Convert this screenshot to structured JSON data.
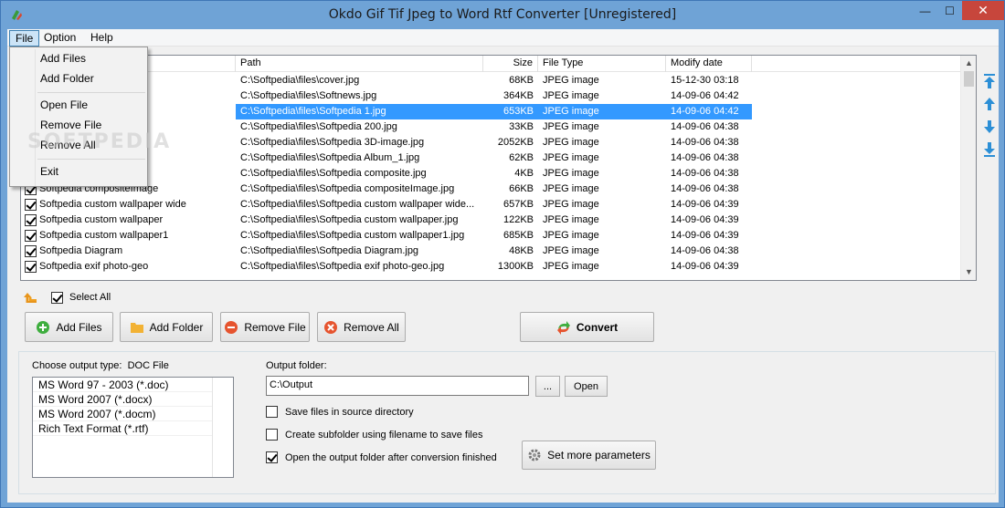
{
  "window": {
    "title": "Okdo Gif Tif Jpeg to Word Rtf Converter [Unregistered]",
    "minimize": "—",
    "maximize": "☐",
    "close": "✕"
  },
  "menubar": {
    "file": "File",
    "option": "Option",
    "help": "Help"
  },
  "file_menu": {
    "add_files": "Add Files",
    "add_folder": "Add Folder",
    "open_file": "Open File",
    "remove_file": "Remove File",
    "remove_all": "Remove All",
    "exit": "Exit"
  },
  "watermark": "SOFTPEDIA",
  "file_list": {
    "columns": {
      "name": "",
      "path": "Path",
      "size": "Size",
      "type": "File Type",
      "date": "Modify date"
    },
    "rows": [
      {
        "name": "",
        "path": "C:\\Softpedia\\files\\cover.jpg",
        "size": "68KB",
        "type": "JPEG image",
        "date": "15-12-30 03:18",
        "checked": true
      },
      {
        "name": "",
        "path": "C:\\Softpedia\\files\\Softnews.jpg",
        "size": "364KB",
        "type": "JPEG image",
        "date": "14-09-06 04:42",
        "checked": true
      },
      {
        "name": "",
        "path": "C:\\Softpedia\\files\\Softpedia 1.jpg",
        "size": "653KB",
        "type": "JPEG image",
        "date": "14-09-06 04:42",
        "checked": true,
        "selected": true
      },
      {
        "name": "",
        "path": "C:\\Softpedia\\files\\Softpedia 200.jpg",
        "size": "33KB",
        "type": "JPEG image",
        "date": "14-09-06 04:38",
        "checked": true
      },
      {
        "name": "",
        "path": "C:\\Softpedia\\files\\Softpedia 3D-image.jpg",
        "size": "2052KB",
        "type": "JPEG image",
        "date": "14-09-06 04:38",
        "checked": true
      },
      {
        "name": "",
        "path": "C:\\Softpedia\\files\\Softpedia Album_1.jpg",
        "size": "62KB",
        "type": "JPEG image",
        "date": "14-09-06 04:38",
        "checked": true
      },
      {
        "name": "",
        "path": "C:\\Softpedia\\files\\Softpedia composite.jpg",
        "size": "4KB",
        "type": "JPEG image",
        "date": "14-09-06 04:38",
        "checked": true
      },
      {
        "name": "Softpedia compositeImage",
        "path": "C:\\Softpedia\\files\\Softpedia compositeImage.jpg",
        "size": "66KB",
        "type": "JPEG image",
        "date": "14-09-06 04:38",
        "checked": true
      },
      {
        "name": "Softpedia custom wallpaper wide",
        "path": "C:\\Softpedia\\files\\Softpedia custom wallpaper wide...",
        "size": "657KB",
        "type": "JPEG image",
        "date": "14-09-06 04:39",
        "checked": true
      },
      {
        "name": "Softpedia custom wallpaper",
        "path": "C:\\Softpedia\\files\\Softpedia custom wallpaper.jpg",
        "size": "122KB",
        "type": "JPEG image",
        "date": "14-09-06 04:39",
        "checked": true
      },
      {
        "name": "Softpedia custom wallpaper1",
        "path": "C:\\Softpedia\\files\\Softpedia custom wallpaper1.jpg",
        "size": "685KB",
        "type": "JPEG image",
        "date": "14-09-06 04:39",
        "checked": true
      },
      {
        "name": "Softpedia Diagram",
        "path": "C:\\Softpedia\\files\\Softpedia Diagram.jpg",
        "size": "48KB",
        "type": "JPEG image",
        "date": "14-09-06 04:38",
        "checked": true
      },
      {
        "name": "Softpedia exif photo-geo",
        "path": "C:\\Softpedia\\files\\Softpedia exif photo-geo.jpg",
        "size": "1300KB",
        "type": "JPEG image",
        "date": "14-09-06 04:39",
        "checked": true
      }
    ]
  },
  "select_all": {
    "label": "Select All",
    "checked": true
  },
  "buttons": {
    "add_files": "Add Files",
    "add_folder": "Add Folder",
    "remove_file": "Remove File",
    "remove_all": "Remove All",
    "convert": "Convert"
  },
  "output": {
    "choose_type_label": "Choose output type:",
    "choose_type_value": "DOC File",
    "formats": [
      "MS Word 97 - 2003 (*.doc)",
      "MS Word 2007 (*.docx)",
      "MS Word 2007 (*.docm)",
      "Rich Text Format (*.rtf)"
    ],
    "folder_label": "Output folder:",
    "folder_value": "C:\\Output",
    "browse": "...",
    "open": "Open",
    "save_in_source": {
      "label": "Save files in source directory",
      "checked": false
    },
    "create_subfolder": {
      "label": "Create subfolder using filename to save files",
      "checked": false
    },
    "open_after": {
      "label": "Open the output folder after conversion finished",
      "checked": true
    },
    "set_params": "Set more parameters"
  }
}
